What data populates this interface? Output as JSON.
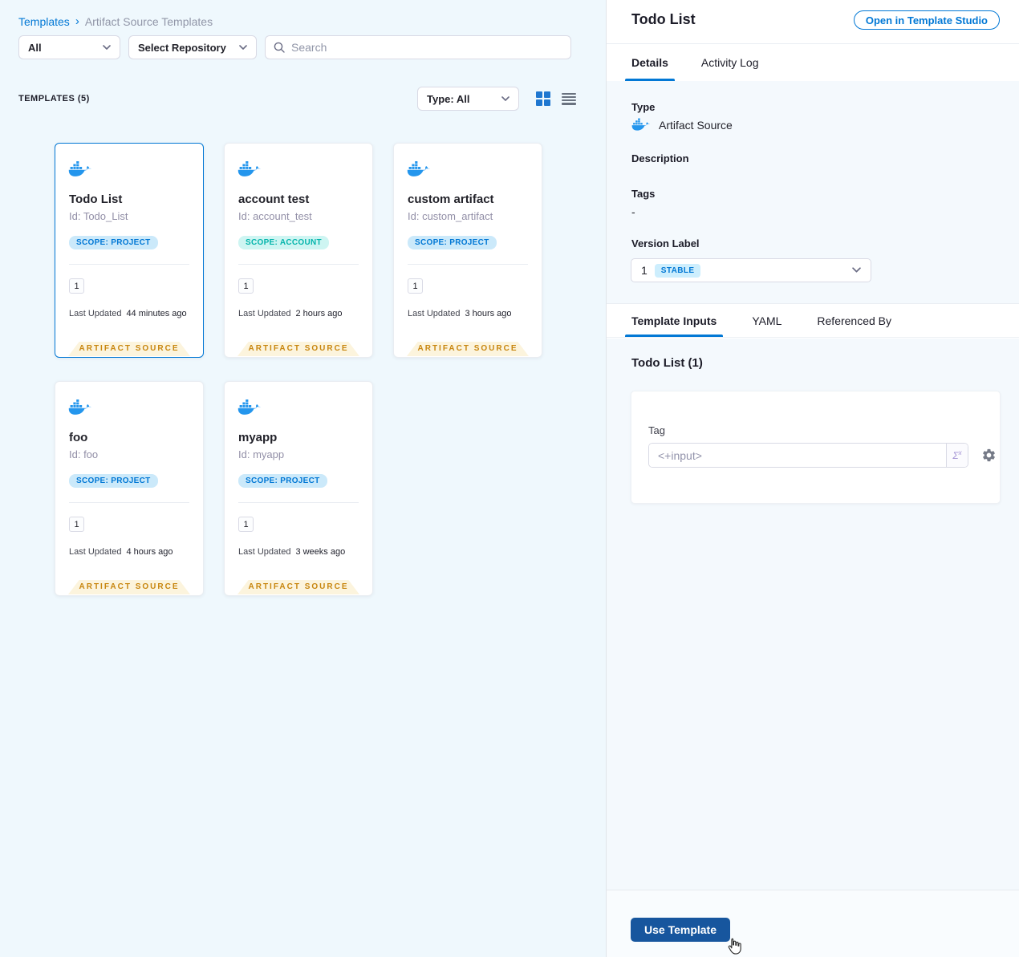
{
  "breadcrumb": {
    "root": "Templates",
    "separator": "›",
    "current": "Artifact Source Templates"
  },
  "filters": {
    "scope_filter_value": "All",
    "repository_filter_value": "Select Repository",
    "search_placeholder": "Search"
  },
  "list_header": {
    "count_label": "TEMPLATES (5)",
    "type_filter_value": "Type: All"
  },
  "cards": [
    {
      "name": "Todo List",
      "id": "Id: Todo_List",
      "scope": "SCOPE: PROJECT",
      "version_count": "1",
      "last_updated_label": "Last Updated",
      "last_updated_value": "44 minutes ago",
      "type_badge": "ARTIFACT SOURCE",
      "selected": true
    },
    {
      "name": "account test",
      "id": "Id: account_test",
      "scope": "SCOPE: ACCOUNT",
      "version_count": "1",
      "last_updated_label": "Last Updated",
      "last_updated_value": "2 hours ago",
      "type_badge": "ARTIFACT SOURCE",
      "selected": false
    },
    {
      "name": "custom artifact",
      "id": "Id: custom_artifact",
      "scope": "SCOPE: PROJECT",
      "version_count": "1",
      "last_updated_label": "Last Updated",
      "last_updated_value": "3 hours ago",
      "type_badge": "ARTIFACT SOURCE",
      "selected": false
    },
    {
      "name": "foo",
      "id": "Id: foo",
      "scope": "SCOPE: PROJECT",
      "version_count": "1",
      "last_updated_label": "Last Updated",
      "last_updated_value": "4 hours ago",
      "type_badge": "ARTIFACT SOURCE",
      "selected": false
    },
    {
      "name": "myapp",
      "id": "Id: myapp",
      "scope": "SCOPE: PROJECT",
      "version_count": "1",
      "last_updated_label": "Last Updated",
      "last_updated_value": "3 weeks ago",
      "type_badge": "ARTIFACT SOURCE",
      "selected": false
    }
  ],
  "panel": {
    "title": "Todo List",
    "open_studio_button": "Open in Template Studio",
    "tabs": {
      "details": "Details",
      "activity_log": "Activity Log"
    },
    "details": {
      "type_label": "Type",
      "type_value": "Artifact Source",
      "description_label": "Description",
      "tags_label": "Tags",
      "tags_value": "-",
      "version_label": "Version Label",
      "version_value": "1",
      "version_badge": "STABLE"
    },
    "inner_tabs": {
      "template_inputs": "Template Inputs",
      "yaml": "YAML",
      "referenced_by": "Referenced By"
    },
    "inputs": {
      "section_title": "Todo List (1)",
      "tag_label": "Tag",
      "tag_placeholder": "<+input>",
      "expression_button": "Σ"
    },
    "use_template_button": "Use Template"
  },
  "colors": {
    "primary_blue": "#0278d5",
    "docker_blue": "#2496ed",
    "use_template_bg": "#17569e",
    "scope_project_bg": "#cbe9fa",
    "scope_account_bg": "#cef5f2",
    "scope_account_text": "#06b5ac",
    "artifact_ribbon_bg": "#fcf4dd",
    "artifact_ribbon_text": "#c8860f",
    "stable_badge_bg": "#cdeefd",
    "page_bg": "#eff8fd",
    "panel_section_bg": "#f4f9fd"
  }
}
